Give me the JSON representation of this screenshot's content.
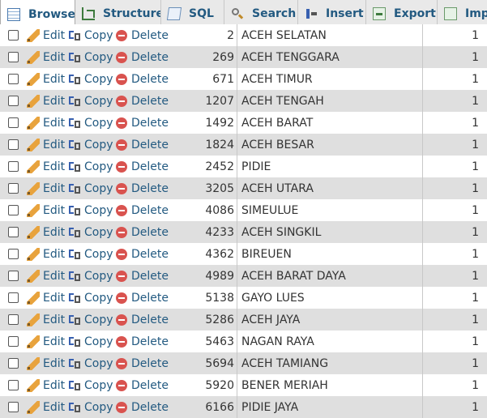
{
  "tabs": [
    {
      "label": "Browse",
      "icon": "browse-icon"
    },
    {
      "label": "Structure",
      "icon": "structure-icon"
    },
    {
      "label": "SQL",
      "icon": "sql-icon"
    },
    {
      "label": "Search",
      "icon": "search-icon"
    },
    {
      "label": "Insert",
      "icon": "insert-icon"
    },
    {
      "label": "Export",
      "icon": "export-icon"
    },
    {
      "label": "Imp",
      "icon": "import-icon"
    }
  ],
  "actions": {
    "edit": "Edit",
    "copy": "Copy",
    "delete": "Delete"
  },
  "rows": [
    {
      "id": "2",
      "name": "ACEH SELATAN",
      "last": "1"
    },
    {
      "id": "269",
      "name": "ACEH TENGGARA",
      "last": "1"
    },
    {
      "id": "671",
      "name": "ACEH TIMUR",
      "last": "1"
    },
    {
      "id": "1207",
      "name": "ACEH TENGAH",
      "last": "1"
    },
    {
      "id": "1492",
      "name": "ACEH BARAT",
      "last": "1"
    },
    {
      "id": "1824",
      "name": "ACEH BESAR",
      "last": "1"
    },
    {
      "id": "2452",
      "name": "PIDIE",
      "last": "1"
    },
    {
      "id": "3205",
      "name": "ACEH UTARA",
      "last": "1"
    },
    {
      "id": "4086",
      "name": "SIMEULUE",
      "last": "1"
    },
    {
      "id": "4233",
      "name": "ACEH SINGKIL",
      "last": "1"
    },
    {
      "id": "4362",
      "name": "BIREUEN",
      "last": "1"
    },
    {
      "id": "4989",
      "name": "ACEH BARAT DAYA",
      "last": "1"
    },
    {
      "id": "5138",
      "name": "GAYO LUES",
      "last": "1"
    },
    {
      "id": "5286",
      "name": "ACEH JAYA",
      "last": "1"
    },
    {
      "id": "5463",
      "name": "NAGAN RAYA",
      "last": "1"
    },
    {
      "id": "5694",
      "name": "ACEH TAMIANG",
      "last": "1"
    },
    {
      "id": "5920",
      "name": "BENER MERIAH",
      "last": "1"
    },
    {
      "id": "6166",
      "name": "PIDIE JAYA",
      "last": "1"
    }
  ]
}
